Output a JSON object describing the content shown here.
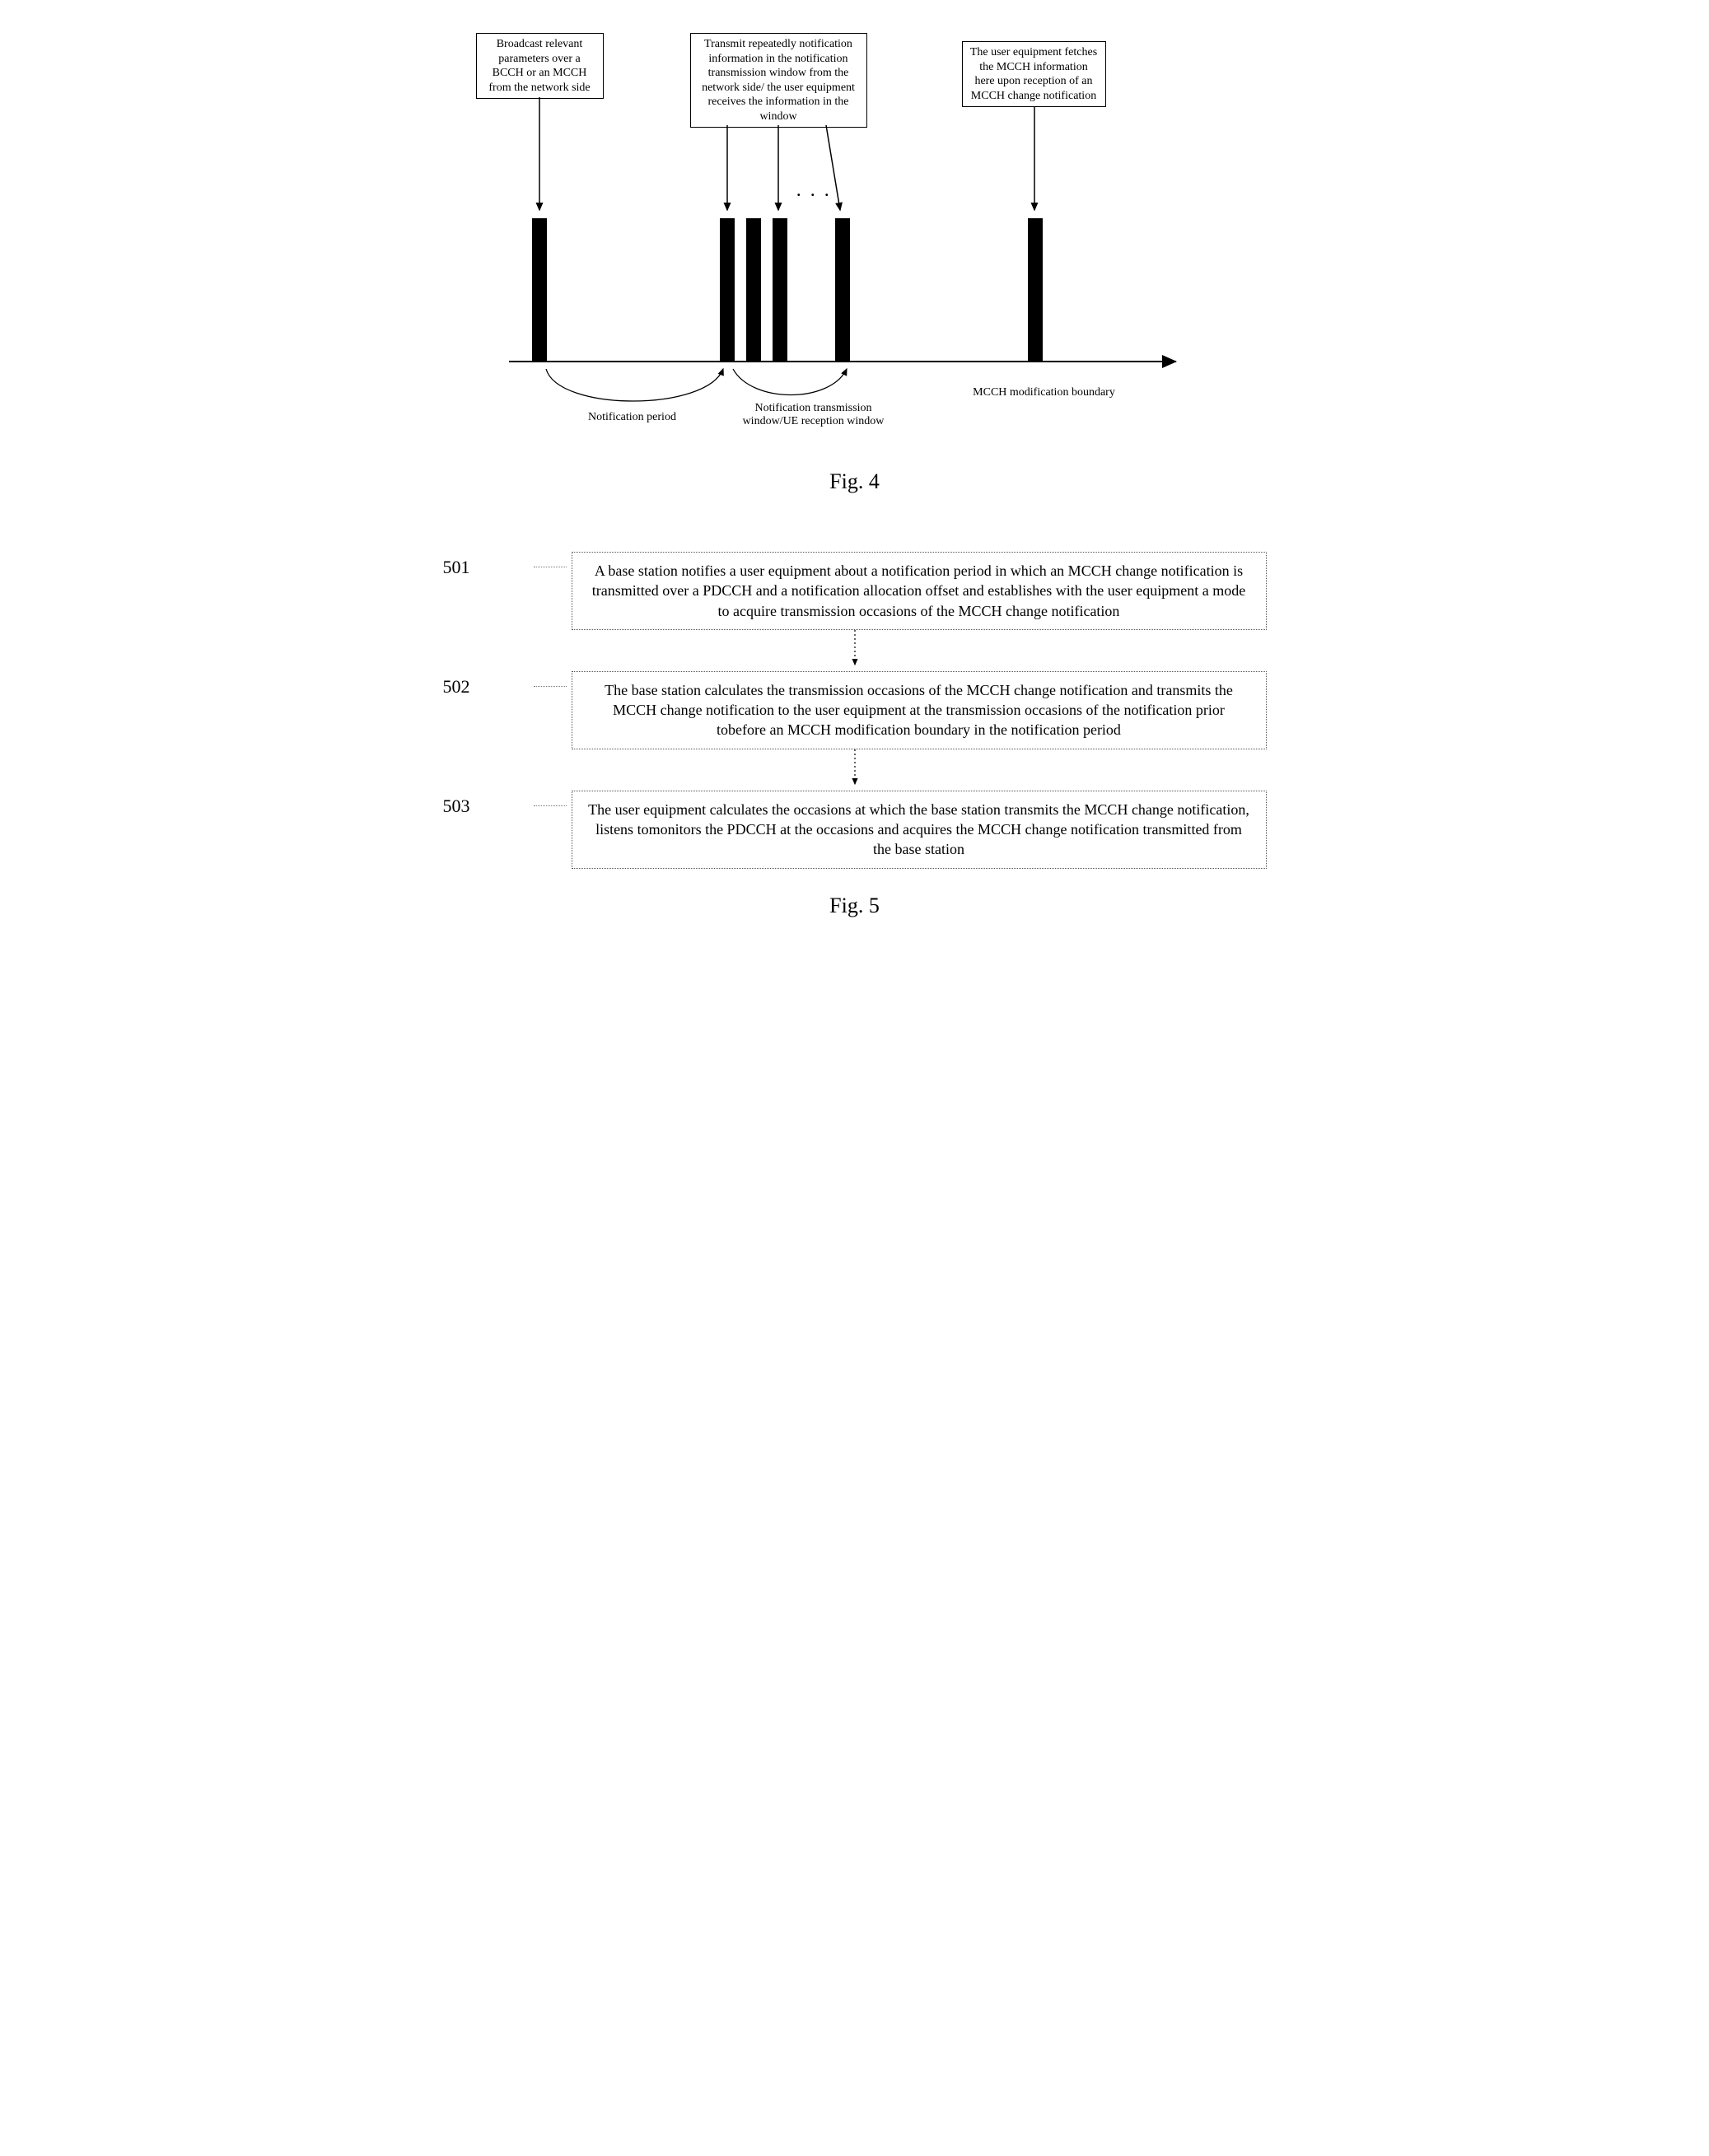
{
  "fig4": {
    "box1": "Broadcast relevant parameters over a BCCH or an MCCH from the network side",
    "box2": "Transmit repeatedly notification information in the notification transmission window from the network side/ the user equipment receives the information in the window",
    "box3": "The user equipment fetches the MCCH information here upon reception of an MCCH change notification",
    "ellipsis": ". . .",
    "label_period": "Notification period",
    "label_window": "Notification transmission window/UE reception window",
    "label_boundary": "MCCH modification boundary",
    "caption": "Fig. 4"
  },
  "fig5": {
    "steps": [
      {
        "num": "501",
        "text": "A base station notifies a user equipment about a notification period in which an MCCH change notification is transmitted over a PDCCH and a notification allocation offset and establishes with the user equipment a mode to acquire transmission occasions of the MCCH change notification"
      },
      {
        "num": "502",
        "text": "The base station calculates the transmission occasions of the MCCH change notification and transmits the MCCH change notification to the user equipment at the transmission occasions of the notification prior tobefore an MCCH modification boundary in the notification period"
      },
      {
        "num": "503",
        "text": "The user equipment calculates the occasions at which the base station transmits the MCCH change notification, listens tomonitors the PDCCH at the occasions and acquires the MCCH change notification transmitted from the base station"
      }
    ],
    "caption": "Fig. 5"
  }
}
